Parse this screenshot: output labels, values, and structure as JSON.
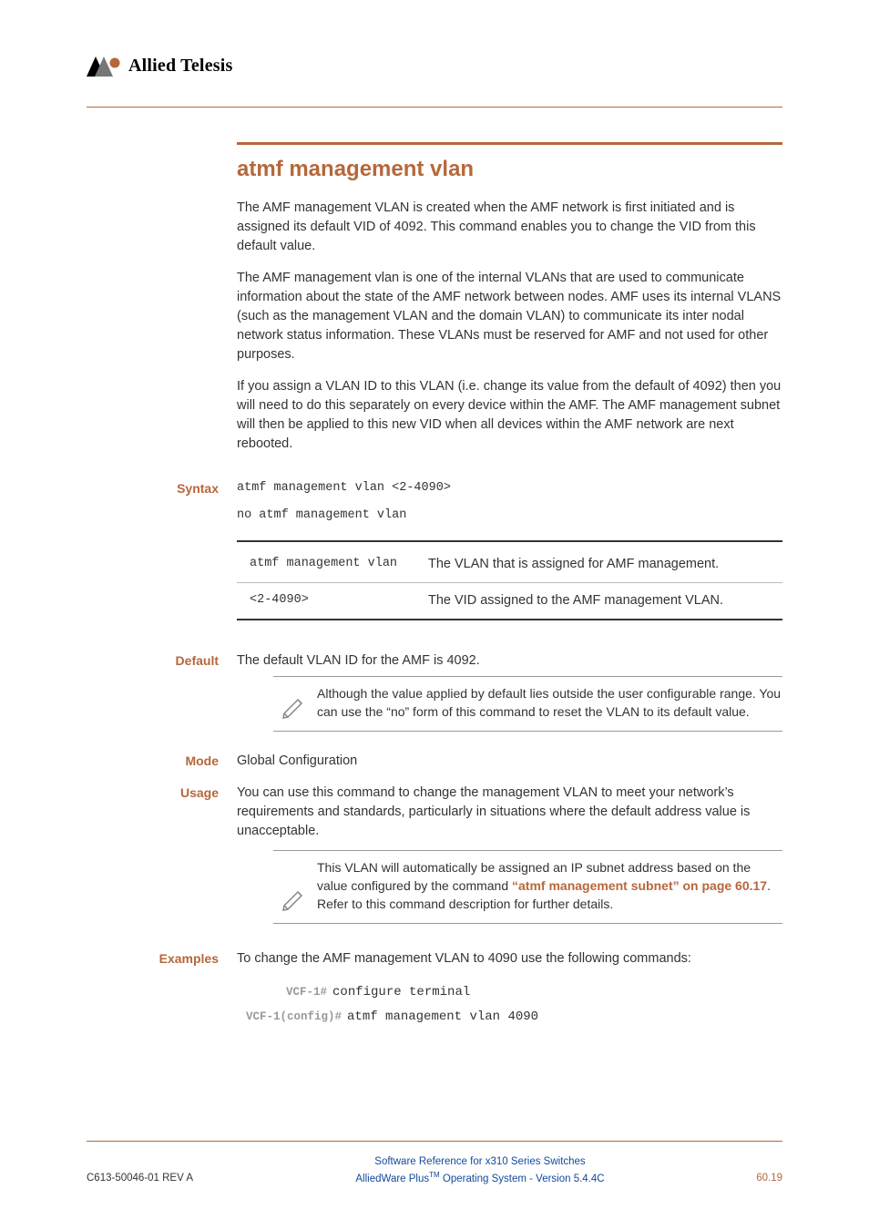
{
  "logo": {
    "text": "Allied Telesis"
  },
  "title": "atmf management vlan",
  "intro": {
    "p1": "The AMF management VLAN is created when the AMF network is first initiated and is assigned its default VID of 4092. This command enables you to change the VID from this default value.",
    "p2": "The AMF management vlan is one of the internal VLANs that are used to communicate information about the state of the AMF network between nodes. AMF uses its internal VLANS (such as the management VLAN and the domain VLAN) to communicate its inter nodal network status information. These VLANs must be reserved for AMF and not used for other purposes.",
    "p3": "If you assign a VLAN ID to this VLAN (i.e. change its value from the default of 4092) then you will need to do this separately on every device within the AMF. The AMF management subnet will then be applied to this new VID when all devices within the AMF network are next rebooted."
  },
  "labels": {
    "syntax": "Syntax",
    "default": "Default",
    "mode": "Mode",
    "usage": "Usage",
    "examples": "Examples"
  },
  "syntax": {
    "line1": "atmf management vlan <2-4090>",
    "line2": "no atmf management vlan"
  },
  "params": [
    {
      "name": "atmf management vlan",
      "desc": "The VLAN that is assigned for AMF management."
    },
    {
      "name": "<2-4090>",
      "desc": "The VID assigned to the AMF management VLAN."
    }
  ],
  "default": {
    "text": "The default VLAN ID for the AMF is 4092.",
    "note": "Although the value applied by default lies outside the user configurable range. You can use the “no” form of this command to reset the VLAN to its default value."
  },
  "mode": "Global Configuration",
  "usage": {
    "text": "You can use this command to change the management VLAN to meet your network’s requirements and standards, particularly in situations where the default address value is unacceptable.",
    "note_pre": "This VLAN will automatically be assigned an IP subnet address based on the value configured by the command ",
    "note_link1": "“atmf management subnet” on ",
    "note_link2": "page 60.17",
    "note_post": ". Refer to this command description for further details."
  },
  "examples": {
    "intro": "To change the AMF management VLAN to 4090 use the following commands:",
    "lines": [
      {
        "prompt": "VCF-1#",
        "cmd": "configure terminal"
      },
      {
        "prompt": "VCF-1(config)#",
        "cmd": "atmf management vlan 4090"
      }
    ]
  },
  "footer": {
    "left": "C613-50046-01 REV A",
    "center_l1": "Software Reference for x310 Series Switches",
    "center_l2_pre": "AlliedWare Plus",
    "center_l2_tm": "TM",
    "center_l2_post": " Operating System - Version 5.4.4C",
    "right": "60.19"
  }
}
